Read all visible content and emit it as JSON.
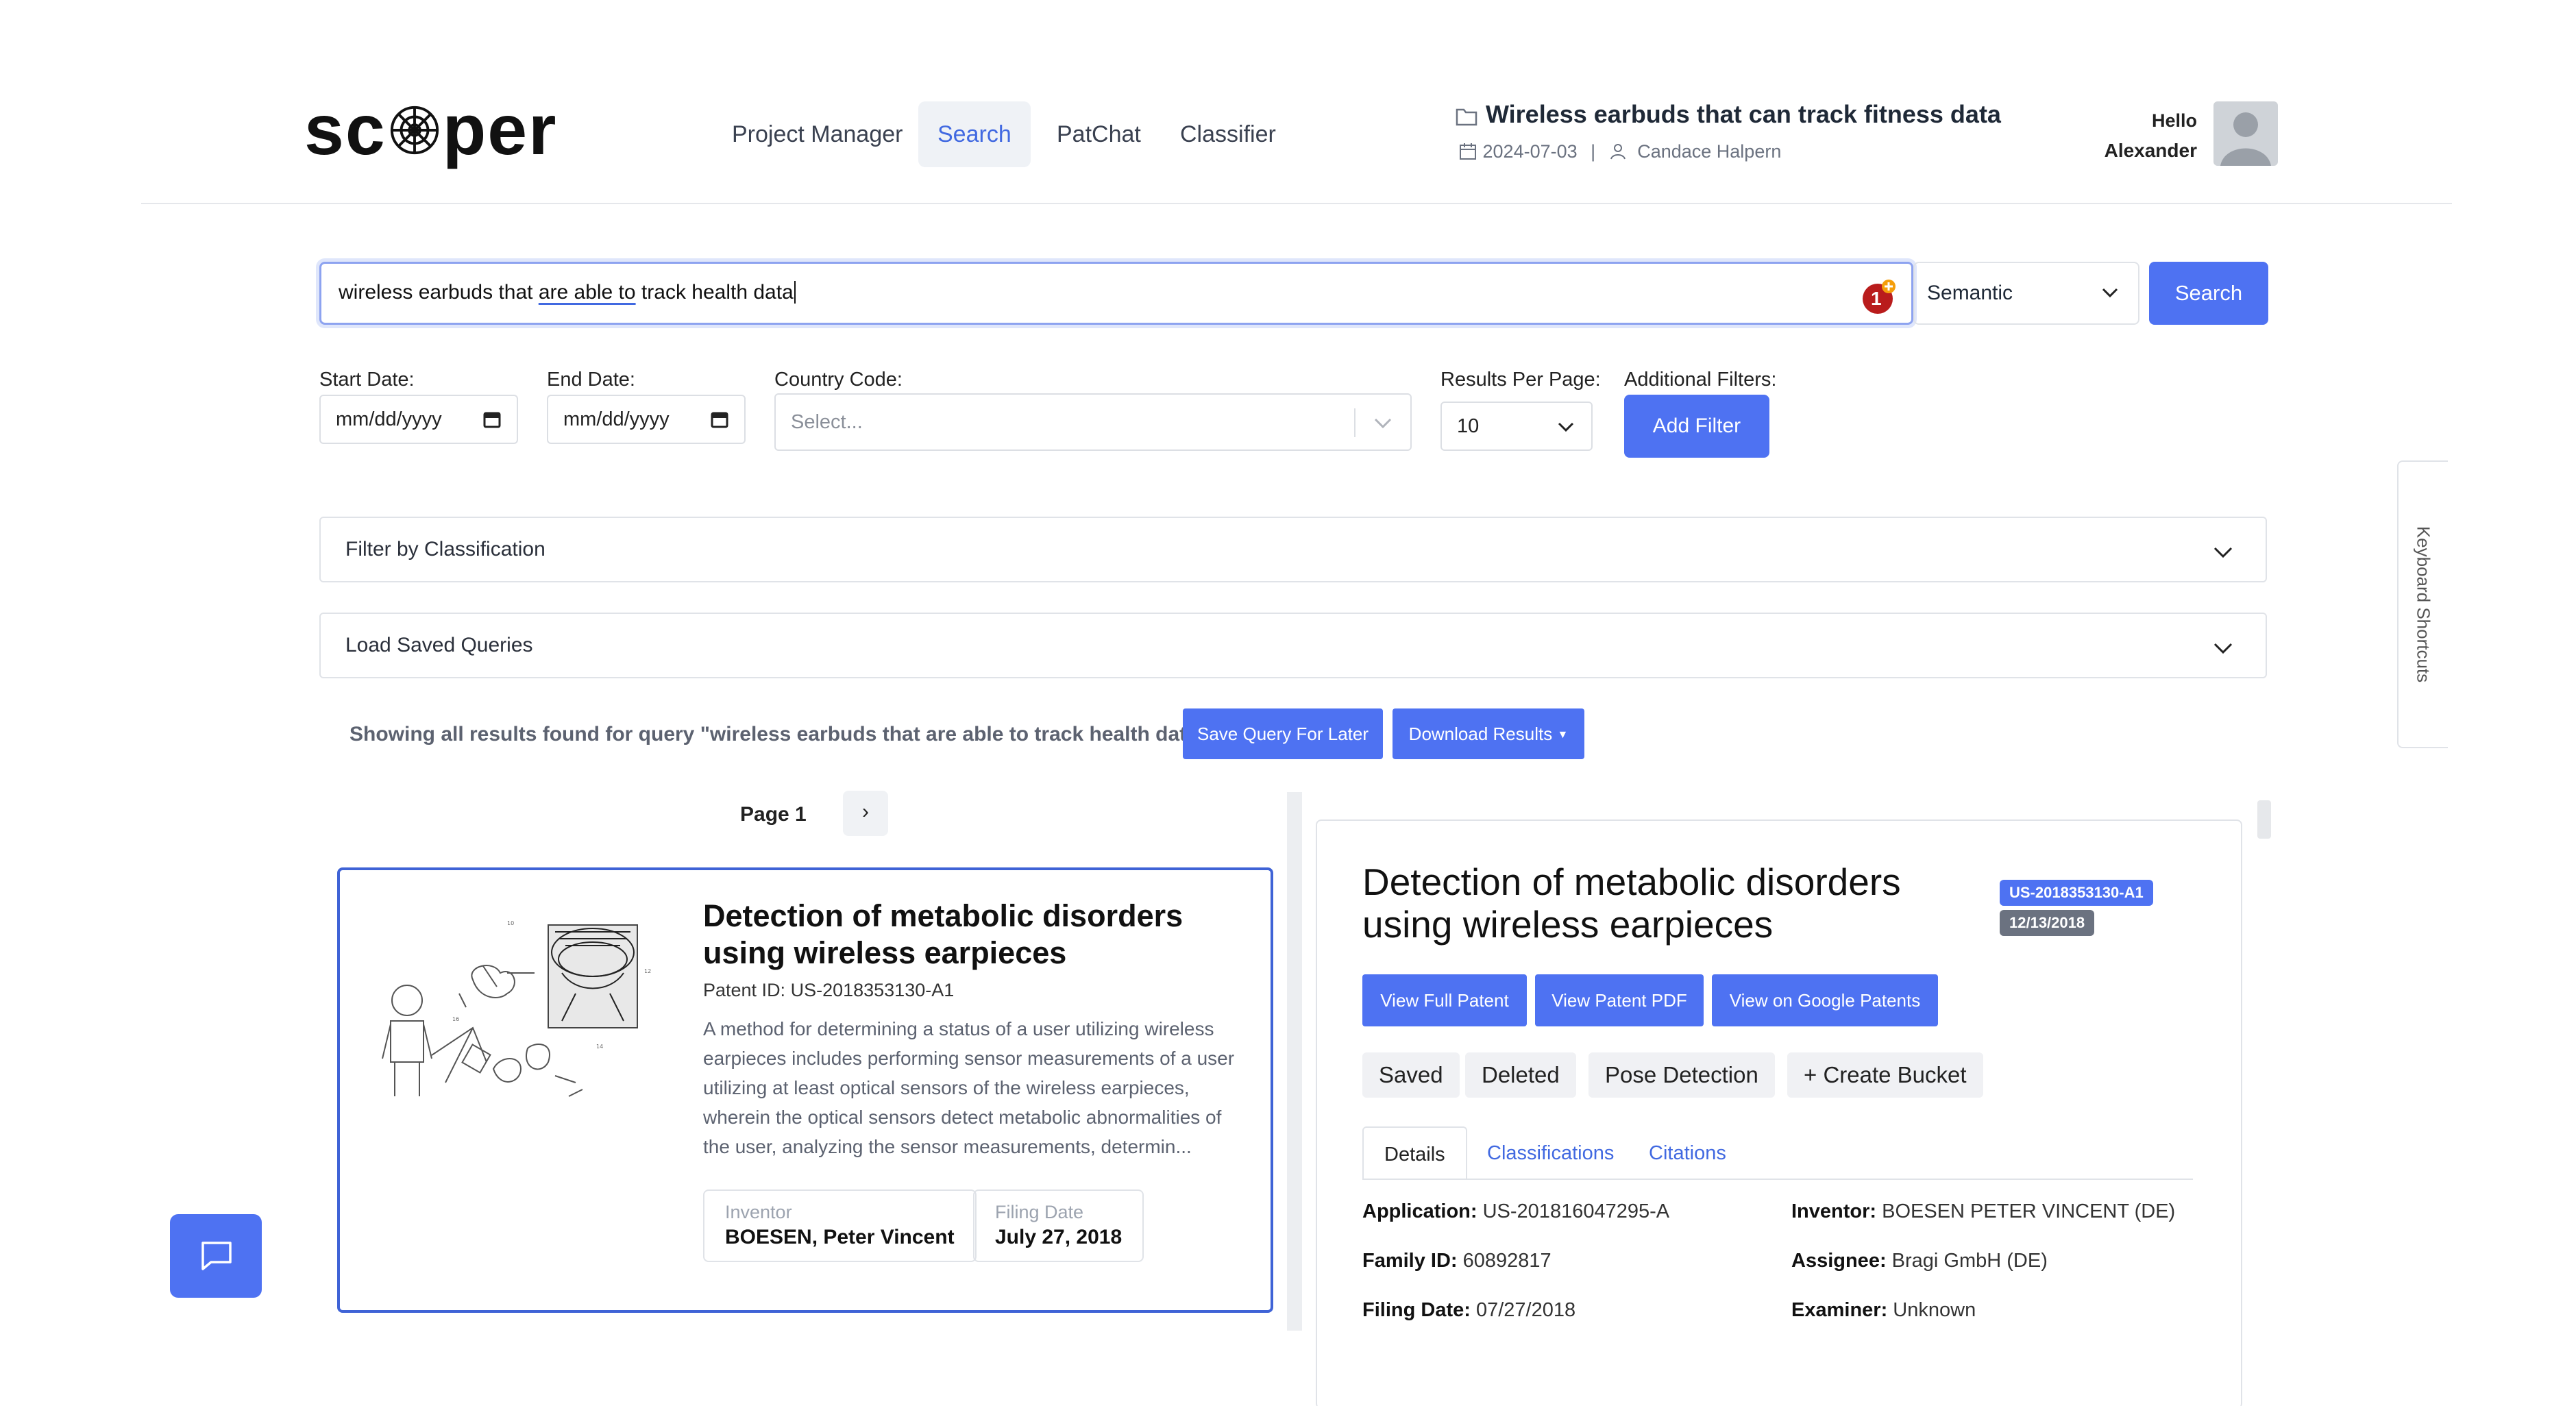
{
  "header": {
    "logo": {
      "left": "sc",
      "right": "per"
    },
    "nav": [
      {
        "label": "Project Manager"
      },
      {
        "label": "Search"
      },
      {
        "label": "PatChat"
      },
      {
        "label": "Classifier"
      }
    ],
    "project": {
      "title": "Wireless earbuds that can track fitness data",
      "date": "2024-07-03",
      "separator": "|",
      "owner": "Candace Halpern"
    },
    "user": {
      "greeting": "Hello",
      "name": "Alexander"
    }
  },
  "search": {
    "query_pre": "wireless earbuds that ",
    "query_underlined": "are able to",
    "query_post": " track health data",
    "badge_count": "1",
    "mode": "Semantic",
    "button": "Search"
  },
  "filters": {
    "start_label": "Start Date:",
    "start_value": "mm/dd/yyyy",
    "end_label": "End Date:",
    "end_value": "mm/dd/yyyy",
    "country_label": "Country Code:",
    "country_placeholder": "Select...",
    "rpp_label": "Results Per Page:",
    "rpp_value": "10",
    "additional_label": "Additional Filters:",
    "add_button": "Add Filter"
  },
  "accordions": {
    "classification": "Filter by Classification",
    "saved": "Load Saved Queries"
  },
  "results": {
    "showing": "Showing all results found for query \"wireless earbuds that are able to track health data\"",
    "save_button": "Save Query For Later",
    "download_button": "Download Results",
    "page_label": "Page 1",
    "next": "›"
  },
  "card": {
    "title": "Detection of metabolic disorders using wireless earpieces",
    "patent_id": "Patent ID: US-2018353130-A1",
    "abstract": "A method for determining a status of a user utilizing wireless earpieces includes performing sensor measurements of a user utilizing at least optical sensors of the wireless earpieces, wherein the optical sensors detect metabolic abnormalities of the user, analyzing the sensor measurements, determin...",
    "inventor_label": "Inventor",
    "inventor_value": "BOESEN, Peter Vincent",
    "filing_label": "Filing Date",
    "filing_value": "July 27, 2018"
  },
  "detail": {
    "title": "Detection of metabolic disorders using wireless earpieces",
    "tag_id": "US-2018353130-A1",
    "tag_date": "12/13/2018",
    "buttons": [
      "View Full Patent",
      "View Patent PDF",
      "View on Google Patents"
    ],
    "pills": [
      "Saved",
      "Deleted",
      "Pose Detection",
      "+ Create Bucket"
    ],
    "tabs": [
      "Details",
      "Classifications",
      "Citations"
    ],
    "facts": {
      "application_label": "Application:",
      "application_value": "US-201816047295-A",
      "inventor_label": "Inventor:",
      "inventor_value": "BOESEN PETER VINCENT (DE)",
      "family_label": "Family ID:",
      "family_value": "60892817",
      "assignee_label": "Assignee:",
      "assignee_value": "Bragi GmbH (DE)",
      "filing_label": "Filing Date:",
      "filing_value": "07/27/2018",
      "examiner_label": "Examiner:",
      "examiner_value": "Unknown"
    }
  },
  "sidebar": {
    "keyboard_shortcuts": "Keyboard Shortcuts"
  },
  "colors": {
    "accent": "#4e72f2",
    "card_border": "#3f63d6",
    "tag_id": "#4e72f2",
    "tag_date": "#6b7280",
    "badge": "#b91c1c"
  }
}
